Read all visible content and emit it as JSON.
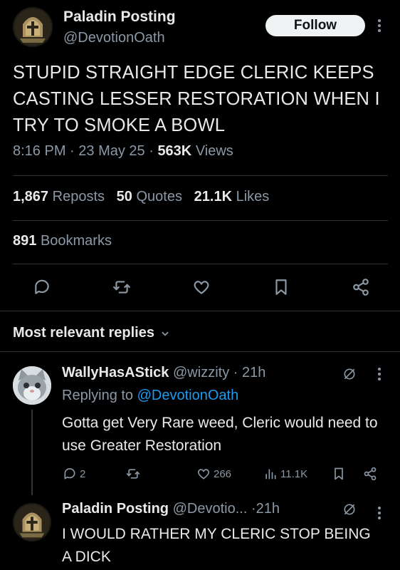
{
  "post": {
    "author_name": "Paladin Posting",
    "author_handle": "@DevotionOath",
    "follow_label": "Follow",
    "text": "STUPID STRAIGHT EDGE CLERIC KEEPS CASTING LESSER RESTORATION WHEN I TRY TO SMOKE A BOWL",
    "time": "8:16 PM",
    "date": "23 May 25",
    "views_count": "563K",
    "views_label": "Views",
    "reposts_count": "1,867",
    "reposts_label": "Reposts",
    "quotes_count": "50",
    "quotes_label": "Quotes",
    "likes_count": "21.1K",
    "likes_label": "Likes",
    "bookmarks_count": "891",
    "bookmarks_label": "Bookmarks"
  },
  "actions": {
    "icons": [
      "reply-icon",
      "repost-icon",
      "like-icon",
      "bookmark-icon",
      "share-icon"
    ]
  },
  "replies_header": {
    "label": "Most relevant replies"
  },
  "replies": [
    {
      "name": "WallyHasAStick",
      "handle": "@wizzity",
      "time": "21h",
      "replying_prefix": "Replying to",
      "replying_to": "@DevotionOath",
      "text": "Gotta get Very Rare weed, Cleric would need to use Greater Restoration",
      "reply_count": "2",
      "like_count": "266",
      "view_count": "11.1K"
    },
    {
      "name": "Paladin Posting",
      "handle": "@Devotio...",
      "time": "21h",
      "text": "I WOULD RATHER MY CLERIC STOP BEING A DICK"
    }
  ],
  "colors": {
    "background": "#000000",
    "text": "#e7e9ea",
    "secondary": "#8b98a5",
    "accent": "#1d9bf0",
    "divider": "#2f3336"
  }
}
